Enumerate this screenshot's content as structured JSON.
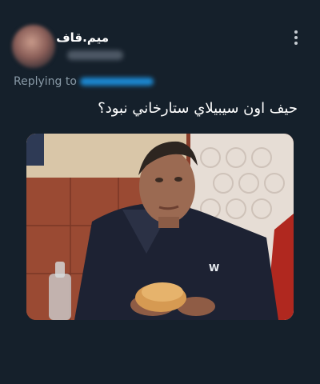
{
  "tweet": {
    "display_name": "ميم.قاف",
    "replying_to_label": "Replying to",
    "text": "حيف اون سيبيلاي ستارخاني نبود؟",
    "media": {
      "shirt_logo": "W"
    }
  },
  "icons": {
    "more": "more-vertical-icon"
  }
}
